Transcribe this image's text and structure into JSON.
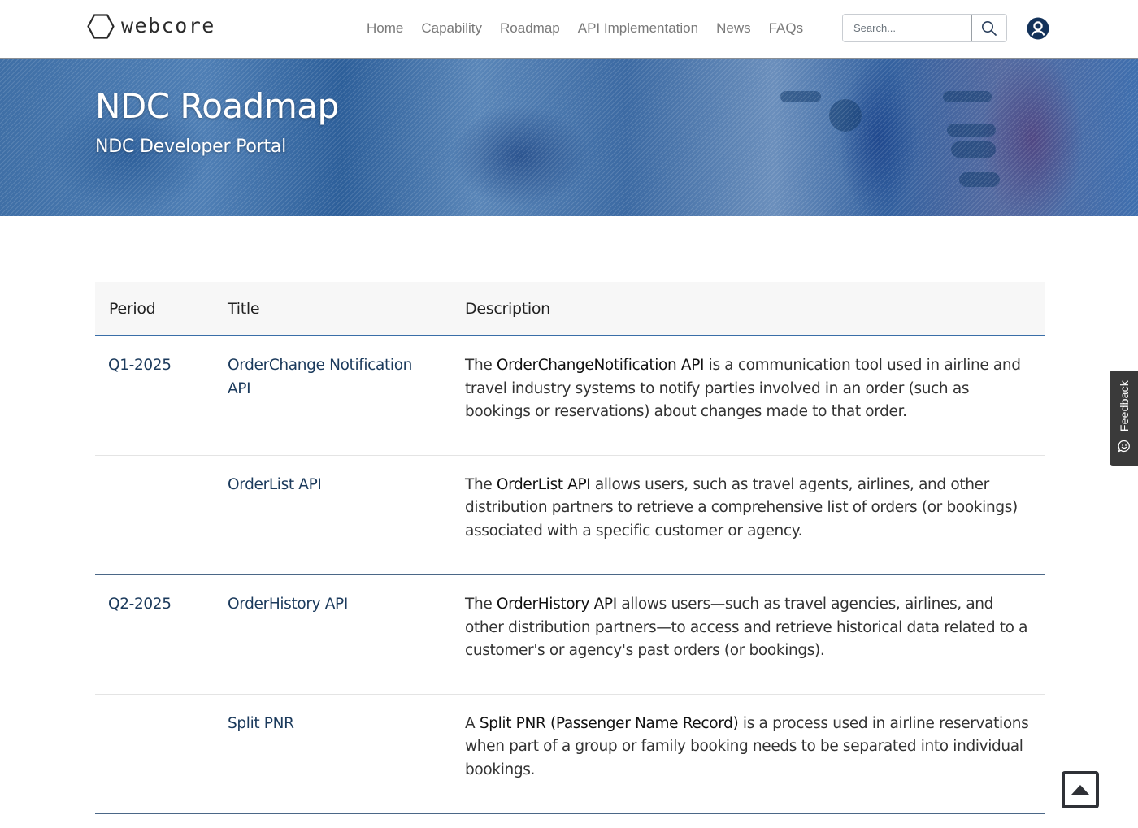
{
  "brand": {
    "name": "webcore"
  },
  "nav": {
    "items": [
      {
        "label": "Home"
      },
      {
        "label": "Capability"
      },
      {
        "label": "Roadmap"
      },
      {
        "label": "API Implementation"
      },
      {
        "label": "News"
      },
      {
        "label": "FAQs"
      }
    ]
  },
  "search": {
    "placeholder": "Search...",
    "value": "",
    "button_icon": "search-icon"
  },
  "user": {
    "icon": "user-circle-icon"
  },
  "hero": {
    "title": "NDC Roadmap",
    "subtitle": "NDC Developer Portal"
  },
  "table": {
    "headers": {
      "period": "Period",
      "title": "Title",
      "description": "Description"
    },
    "rows": [
      {
        "period": "Q1-2025",
        "title": "OrderChange Notification API",
        "desc_pre": "The ",
        "desc_term": "OrderChangeNotification API",
        "desc_post": " is a communication tool used in airline and travel industry systems to notify parties involved in an order (such as bookings or reservations) about changes made to that order."
      },
      {
        "period": "",
        "title": "OrderList API",
        "desc_pre": "The ",
        "desc_term": "OrderList API",
        "desc_post": " allows users, such as travel agents, airlines, and other distribution partners to retrieve a comprehensive list of orders (or bookings) associated with a specific customer or agency."
      },
      {
        "period": "Q2-2025",
        "title": "OrderHistory API",
        "desc_pre": "The ",
        "desc_term": "OrderHistory API",
        "desc_post": " allows users—such as travel agencies, airlines, and other distribution partners—to access and retrieve historical data related to a customer's or agency's past orders (or bookings)."
      },
      {
        "period": "",
        "title": "Split PNR",
        "desc_pre": "A ",
        "desc_term": "Split PNR (Passenger Name Record)",
        "desc_post": " is a process used in airline reservations when part of a group or family booking needs to be separated into individual bookings."
      }
    ]
  },
  "feedback": {
    "label": "Feedback",
    "icon": "chat-smile-icon"
  },
  "back_to_top": {
    "icon": "caret-up-icon"
  },
  "colors": {
    "accent": "#1b3a5c",
    "header_rule": "#3a6ea8",
    "group_rule": "#4b6787",
    "feedback_bg": "#3a3a3a"
  }
}
